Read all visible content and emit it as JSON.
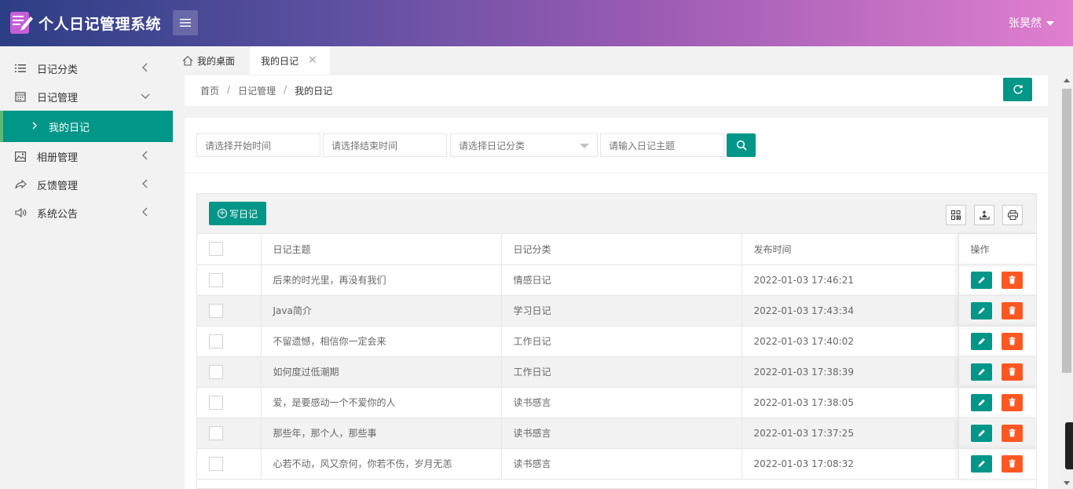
{
  "header": {
    "app_title": "个人日记管理系统",
    "user_name": "张昊然"
  },
  "sidebar": {
    "items": [
      {
        "label": "日记分类",
        "icon": "list-icon"
      },
      {
        "label": "日记管理",
        "icon": "calendar-icon",
        "expanded": true,
        "children": [
          {
            "label": "我的日记",
            "active": true
          }
        ]
      },
      {
        "label": "相册管理",
        "icon": "image-icon"
      },
      {
        "label": "反馈管理",
        "icon": "share-icon"
      },
      {
        "label": "系统公告",
        "icon": "speaker-icon"
      }
    ]
  },
  "tabs": [
    {
      "label": "我的桌面",
      "icon": "home-icon"
    },
    {
      "label": "我的日记",
      "active": true,
      "closable": true
    }
  ],
  "breadcrumb": [
    "首页",
    "日记管理",
    "我的日记"
  ],
  "filters": {
    "start_placeholder": "请选择开始时间",
    "end_placeholder": "请选择结束时间",
    "category_placeholder": "请选择日记分类",
    "topic_placeholder": "请输入日记主题"
  },
  "toolbar": {
    "add_label": "写日记"
  },
  "table": {
    "columns": [
      "日记主题",
      "日记分类",
      "发布时间",
      "操作"
    ],
    "rows": [
      {
        "topic": "后来的时光里，再没有我们",
        "category": "情感日记",
        "time": "2022-01-03 17:46:21"
      },
      {
        "topic": "Java简介",
        "category": "学习日记",
        "time": "2022-01-03 17:43:34"
      },
      {
        "topic": "不留遗憾，相信你一定会来",
        "category": "工作日记",
        "time": "2022-01-03 17:40:02"
      },
      {
        "topic": "如何度过低潮期",
        "category": "工作日记",
        "time": "2022-01-03 17:38:39"
      },
      {
        "topic": "爱，是要感动一个不爱你的人",
        "category": "读书感言",
        "time": "2022-01-03 17:38:05"
      },
      {
        "topic": "那些年，那个人，那些事",
        "category": "读书感言",
        "time": "2022-01-03 17:37:25"
      },
      {
        "topic": "心若不动，风又奈何，你若不伤，岁月无恙",
        "category": "读书感言",
        "time": "2022-01-03 17:08:32"
      }
    ]
  },
  "colors": {
    "primary": "#009688",
    "danger": "#ff5722"
  }
}
